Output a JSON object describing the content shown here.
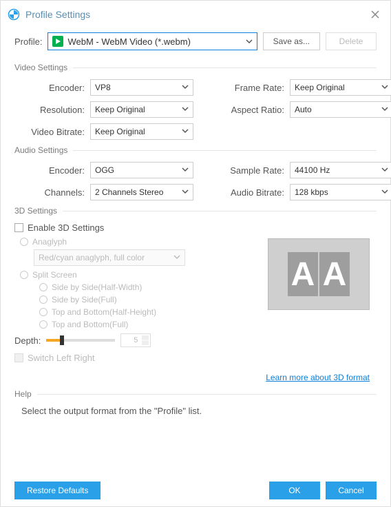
{
  "title": "Profile Settings",
  "profile": {
    "label": "Profile:",
    "value": "WebM - WebM Video (*.webm)",
    "save_as": "Save as...",
    "delete": "Delete"
  },
  "video": {
    "title": "Video Settings",
    "encoder_lbl": "Encoder:",
    "encoder": "VP8",
    "resolution_lbl": "Resolution:",
    "resolution": "Keep Original",
    "vbitrate_lbl": "Video Bitrate:",
    "vbitrate": "Keep Original",
    "framerate_lbl": "Frame Rate:",
    "framerate": "Keep Original",
    "aspect_lbl": "Aspect Ratio:",
    "aspect": "Auto"
  },
  "audio": {
    "title": "Audio Settings",
    "encoder_lbl": "Encoder:",
    "encoder": "OGG",
    "channels_lbl": "Channels:",
    "channels": "2 Channels Stereo",
    "sample_lbl": "Sample Rate:",
    "sample": "44100 Hz",
    "abitrate_lbl": "Audio Bitrate:",
    "abitrate": "128 kbps"
  },
  "threed": {
    "title": "3D Settings",
    "enable": "Enable 3D Settings",
    "anaglyph": "Anaglyph",
    "anaglyph_val": "Red/cyan anaglyph, full color",
    "split": "Split Screen",
    "sbs_hw": "Side by Side(Half-Width)",
    "sbs_full": "Side by Side(Full)",
    "tab_hh": "Top and Bottom(Half-Height)",
    "tab_full": "Top and Bottom(Full)",
    "depth_lbl": "Depth:",
    "depth_val": "5",
    "switch": "Switch Left Right",
    "learn": "Learn more about 3D format"
  },
  "help": {
    "title": "Help",
    "text": "Select the output format from the \"Profile\" list."
  },
  "footer": {
    "restore": "Restore Defaults",
    "ok": "OK",
    "cancel": "Cancel"
  }
}
